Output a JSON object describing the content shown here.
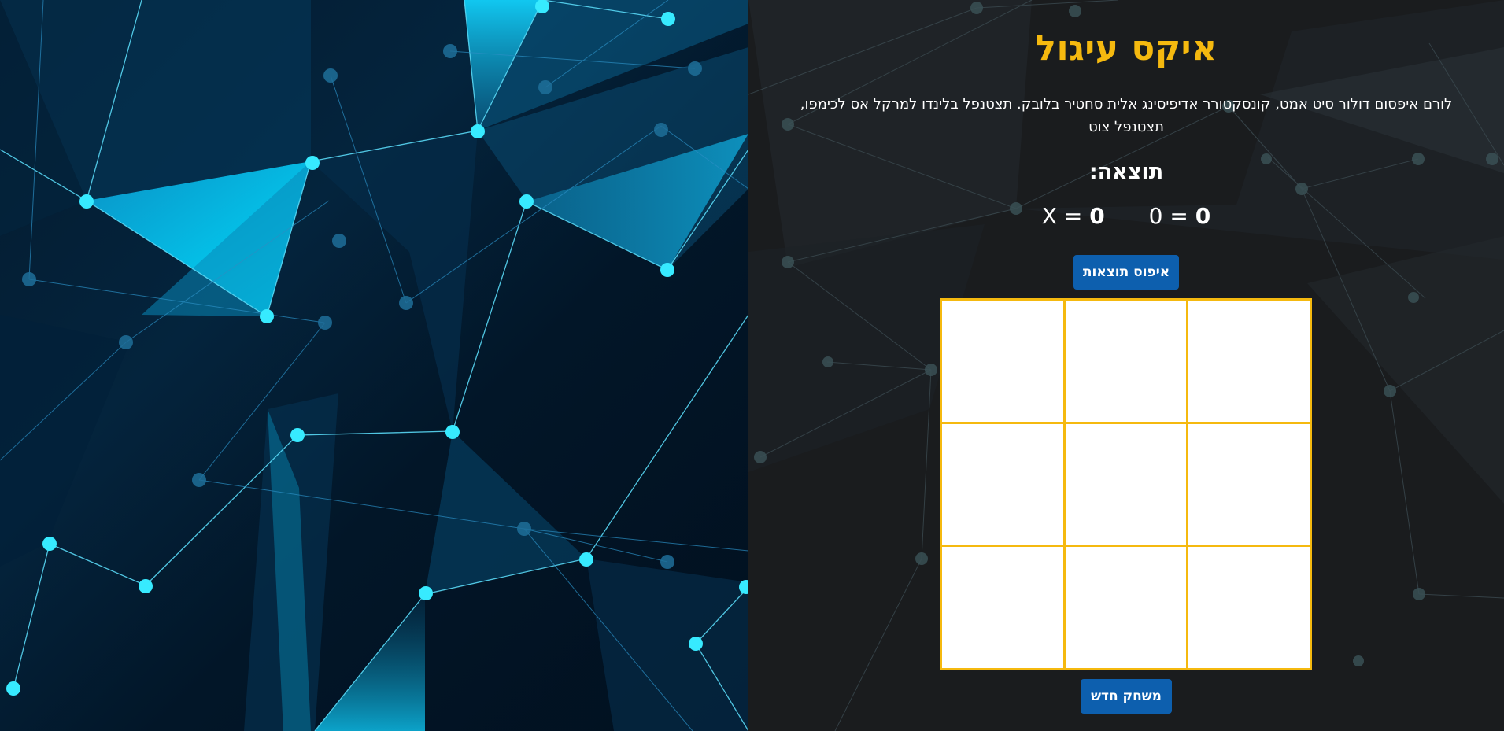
{
  "game": {
    "title": "איקס עיגול",
    "description": "לורם איפסום דולור סיט אמט, קונסקטורר אדיפיסינג אלית סחטיר בלובק. תצטנפל בלינדו למרקל אס לכימפו, תצטנפל צוט",
    "score_heading": "תוצאה:",
    "score_x_label": "X =",
    "score_x_value": "0",
    "score_o_label": "0 =",
    "score_o_value": "0",
    "reset_button_label": "איפוס תוצאות",
    "new_game_button_label": "משחק חדש",
    "board": [
      "",
      "",
      "",
      "",
      "",
      "",
      "",
      "",
      ""
    ]
  },
  "colors": {
    "accent": "#f5b90f",
    "button": "#0d5fae",
    "panel_background": "#1a1c1e",
    "cell": "#ffffff",
    "hero_nodes": "#2ee6ff"
  }
}
